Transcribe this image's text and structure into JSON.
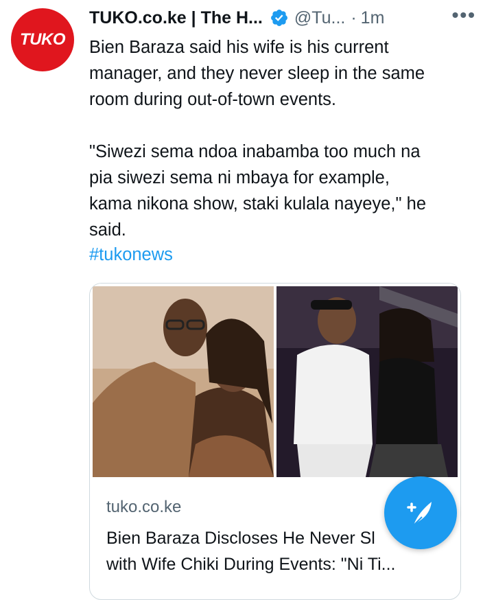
{
  "author": {
    "avatar_text": "TUKO",
    "name": "TUKO.co.ke | The H...",
    "handle": "@Tu...",
    "separator": "·",
    "time": "1m",
    "more": "•••"
  },
  "tweet": {
    "text": "Bien Baraza said his wife is his current\nmanager, and they never sleep in the same\nroom during out-of-town events.\n\n\"Siwezi sema ndoa inabamba too much na\npia siwezi sema ni mbaya for example,\nkama nikona show, staki kulala nayeye,\" he\nsaid.",
    "hashtag": "#tukonews"
  },
  "card": {
    "domain": "tuko.co.ke",
    "title": "Bien Baraza Discloses He Never Sl\nwith Wife Chiki During Events: \"Ni Ti..."
  },
  "colors": {
    "accent": "#1d9bf0",
    "brand": "#e0161e",
    "muted": "#536471"
  },
  "icons": {
    "verified": "verified-badge-icon",
    "more": "more-icon",
    "compose": "compose-tweet-icon"
  }
}
